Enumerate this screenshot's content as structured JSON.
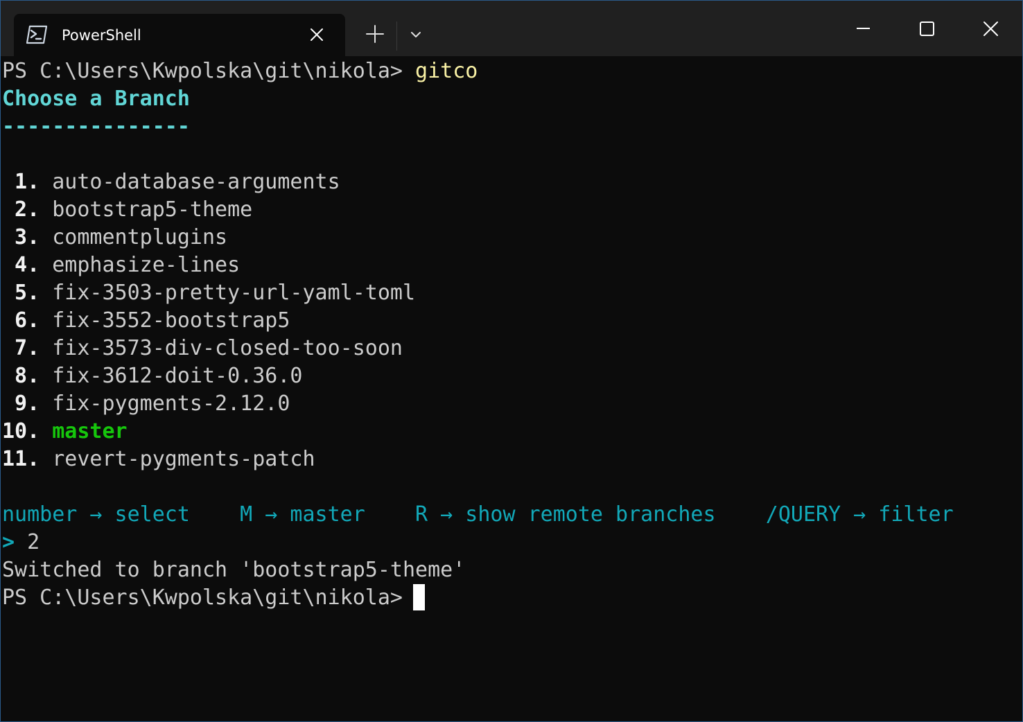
{
  "window": {
    "tab_title": "PowerShell",
    "icons": {
      "tab_icon": "powershell-icon",
      "tab_close": "close-icon",
      "new_tab": "plus-icon",
      "dropdown": "chevron-down-icon",
      "minimize": "minimize-icon",
      "maximize": "maximize-icon",
      "close": "close-icon"
    }
  },
  "terminal": {
    "prompt": "PS C:\\Users\\Kwpolska\\git\\nikola> ",
    "command": "gitco",
    "heading": "Choose a Branch",
    "heading_rule": "---------------",
    "branches": [
      {
        "number": " 1.",
        "name": "auto-database-arguments"
      },
      {
        "number": " 2.",
        "name": "bootstrap5-theme"
      },
      {
        "number": " 3.",
        "name": "commentplugins"
      },
      {
        "number": " 4.",
        "name": "emphasize-lines"
      },
      {
        "number": " 5.",
        "name": "fix-3503-pretty-url-yaml-toml"
      },
      {
        "number": " 6.",
        "name": "fix-3552-bootstrap5"
      },
      {
        "number": " 7.",
        "name": "fix-3573-div-closed-too-soon"
      },
      {
        "number": " 8.",
        "name": "fix-3612-doit-0.36.0"
      },
      {
        "number": " 9.",
        "name": "fix-pygments-2.12.0"
      },
      {
        "number": "10.",
        "name": "master"
      },
      {
        "number": "11.",
        "name": "revert-pygments-patch"
      }
    ],
    "hints": "number → select    M → master    R → show remote branches    /QUERY → filter",
    "input_marker": ">",
    "input_value": " 2",
    "result": "Switched to branch 'bootstrap5-theme'",
    "final_prompt": "PS C:\\Users\\Kwpolska\\git\\nikola> "
  },
  "colors": {
    "background": "#0c0c0c",
    "titlebar": "#202020",
    "text": "#cccccc",
    "command": "#f9f1a5",
    "heading": "#61d6d6",
    "hints": "#12a8b8",
    "current_branch": "#16c60c"
  }
}
